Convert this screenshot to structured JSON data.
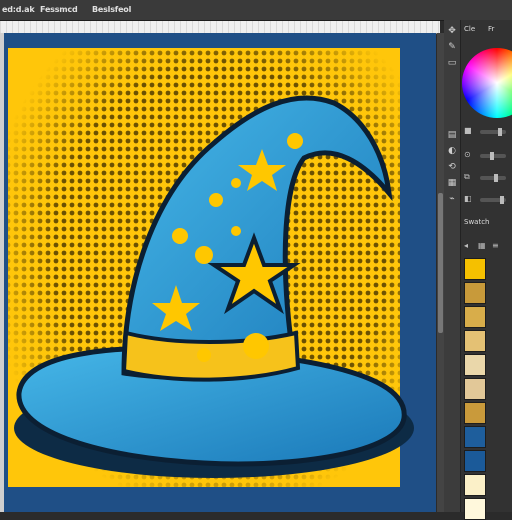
{
  "menubar": {
    "items": [
      "ed:d.ak",
      "Fessmcd",
      "Beslsfeol"
    ]
  },
  "panel": {
    "tabs": [
      "Cle",
      "Fr"
    ],
    "swatches_label": "Swatch",
    "colors": {
      "background": "#323232",
      "wheel_accent": "#ff00ff"
    }
  },
  "artwork": {
    "background_color": "#ffc60a",
    "frame_color": "#1f4f86",
    "hat_color": "#2ea6d8",
    "hat_shadow": "#1a5f8a",
    "band_color": "#f6c21b",
    "star_color": "#ffc700"
  },
  "swatches": [
    {
      "name": "yellow",
      "color": "#f5c000"
    },
    {
      "name": "gold-texture",
      "color": "#c89a3a"
    },
    {
      "name": "mustard-texture",
      "color": "#d8ad4a"
    },
    {
      "name": "tan-texture",
      "color": "#e4c174"
    },
    {
      "name": "pale-texture",
      "color": "#ead7aa"
    },
    {
      "name": "beige-texture",
      "color": "#e2c898"
    },
    {
      "name": "amber-texture",
      "color": "#c99a3b"
    },
    {
      "name": "blue",
      "color": "#1e5e9c"
    },
    {
      "name": "blue-dark",
      "color": "#1b5a99"
    },
    {
      "name": "cream",
      "color": "#fbf0c8"
    },
    {
      "name": "cream-light",
      "color": "#fff8dc"
    }
  ]
}
